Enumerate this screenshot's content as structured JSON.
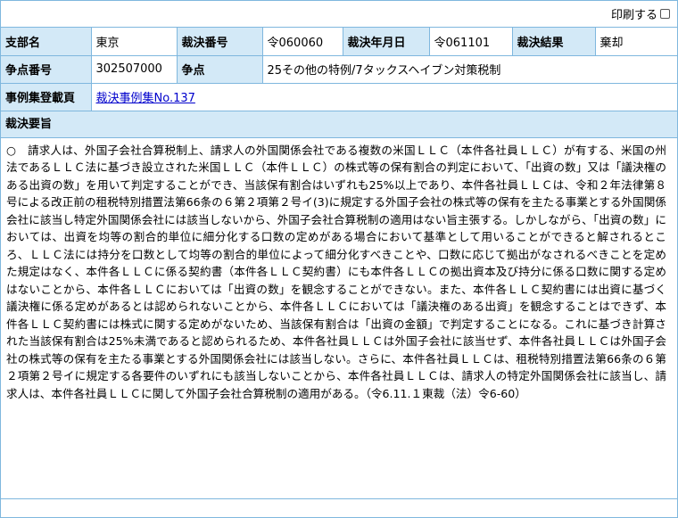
{
  "print": {
    "label": "印刷する"
  },
  "row1": {
    "branch_label": "支部名",
    "branch_value": "東京",
    "decision_no_label": "裁決番号",
    "decision_no_value": "令060060",
    "decision_date_label": "裁決年月日",
    "decision_date_value": "令061101",
    "result_label": "裁決結果",
    "result_value": "棄却"
  },
  "row2": {
    "issue_no_label": "争点番号",
    "issue_no_value": "302507000",
    "issue_label": "争点",
    "issue_value": "25その他の特例/7タックスヘイブン対策税制"
  },
  "row3": {
    "casebook_label": "事例集登載頁",
    "casebook_link": "裁決事例集No.137"
  },
  "summary": {
    "title": "裁決要旨",
    "text": "○　請求人は、外国子会社合算税制上、請求人の外国関係会社である複数の米国ＬＬＣ（本件各社員ＬＬＣ）が有する、米国の州法であるＬＬＣ法に基づき設立された米国ＬＬＣ（本件ＬＬＣ）の株式等の保有割合の判定において、「出資の数」又は「議決権のある出資の数」を用いて判定することができ、当該保有割合はいずれも25%以上であり、本件各社員ＬＬＣは、令和２年法律第８号による改正前の租税特別措置法第66条の６第２項第２号イ(3)に規定する外国子会社の株式等の保有を主たる事業とする外国関係会社に該当し特定外国関係会社には該当しないから、外国子会社合算税制の適用はない旨主張する。しかしながら、「出資の数」においては、出資を均等の割合的単位に細分化する口数の定めがある場合において基準として用いることができると解されるところ、ＬＬＣ法には持分を口数として均等の割合的単位によって細分化すべきことや、口数に応じて拠出がなされるべきことを定めた規定はなく、本件各ＬＬＣに係る契約書（本件各ＬＬＣ契約書）にも本件各ＬＬＣの拠出資本及び持分に係る口数に関する定めはないことから、本件各ＬＬＣにおいては「出資の数」を観念することができない。また、本件各ＬＬＣ契約書には出資に基づく議決権に係る定めがあるとは認められないことから、本件各ＬＬＣにおいては「議決権のある出資」を観念することはできず、本件各ＬＬＣ契約書には株式に関する定めがないため、当該保有割合は「出資の金額」で判定することになる。これに基づき計算された当該保有割合は25%未満であると認められるため、本件各社員ＬＬＣは外国子会社に該当せず、本件各社員ＬＬＣは外国子会社の株式等の保有を主たる事業とする外国関係会社には該当しない。さらに、本件各社員ＬＬＣは、租税特別措置法第66条の６第２項第２号イに規定する各要件のいずれにも該当しないことから、本件各社員ＬＬＣは、請求人の特定外国関係会社に該当し、請求人は、本件各社員ＬＬＣに関して外国子会社合算税制の適用がある。（令6.11.１東裁（法）令6-60）"
  }
}
